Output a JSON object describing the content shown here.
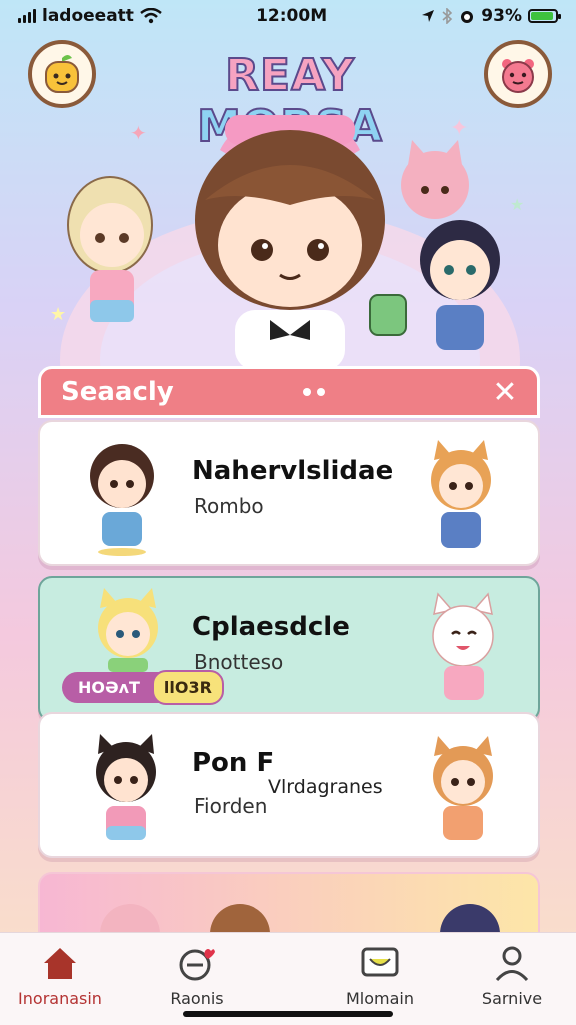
{
  "status_bar": {
    "carrier": "ladoeeatt",
    "time": "12:00M",
    "battery": "93%",
    "battery_level": 0.9
  },
  "header": {
    "title_word1": "REAY",
    "title_word2": "MORSA"
  },
  "panel": {
    "title": "Seaacly",
    "cards": [
      {
        "title": "Nahervlslidae",
        "subtitle": "Rombo"
      },
      {
        "title": "Cplaesdcle",
        "subtitle": "Bnotteso",
        "badge_left": "HOƏʌT",
        "badge_right": "llO3R"
      },
      {
        "title": "Pon F",
        "subtitle": "Fiorden",
        "subtitle2": "Vlrdagranes"
      }
    ]
  },
  "tabs": [
    {
      "label": "Inoranasin",
      "icon": "house-icon",
      "active": true
    },
    {
      "label": "Raonis",
      "icon": "speech-heart-icon",
      "active": false
    },
    {
      "label": "Mlomain",
      "icon": "message-icon",
      "active": false
    },
    {
      "label": "Sarnive",
      "icon": "profile-icon",
      "active": false
    }
  ],
  "colors": {
    "panel_header": "#ef7f86",
    "card_alt": "#c7ece0",
    "active_tab": "#b43333"
  }
}
